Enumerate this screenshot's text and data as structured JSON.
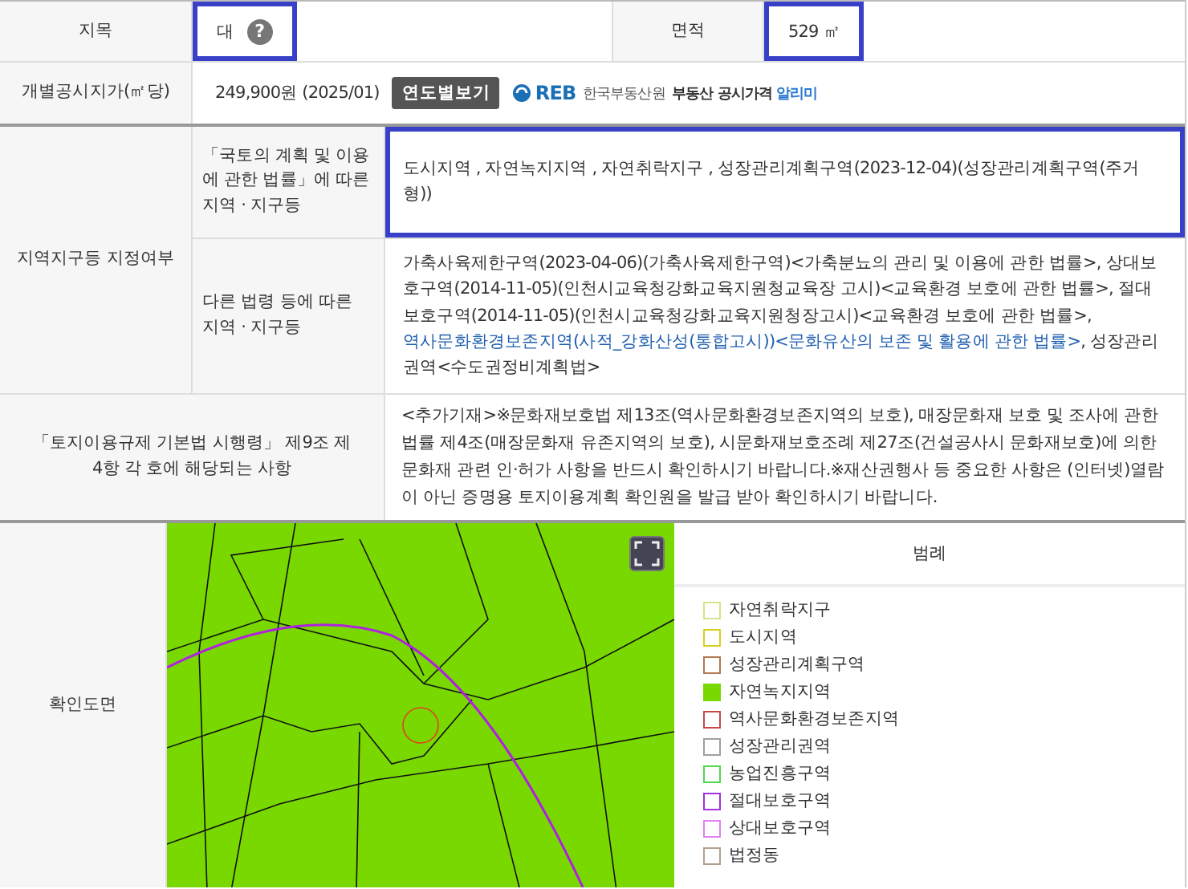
{
  "land_category": {
    "label": "지목",
    "value": "대",
    "help_icon": "?",
    "highlighted": true
  },
  "area": {
    "label": "면적",
    "value": "529 ㎡",
    "highlighted": true
  },
  "official_price": {
    "label": "개별공시지가(㎡당)",
    "value": "249,900원 (2025/01)",
    "button": "연도별보기",
    "logo": {
      "mark": "REB",
      "org": "한국부동산원",
      "service": "부동산 공시가격",
      "brand": "알리미"
    }
  },
  "zoning": {
    "label": "지역지구등 지정여부",
    "rows": [
      {
        "label": "「국토의 계획 및 이용에 관한 법률」에 따른 지역 · 지구등",
        "highlighted": true,
        "segments": [
          {
            "text": "도시지역 , 자연녹지지역 , 자연취락지구 , 성장관리계획구역(2023-12-04)(성장관리계획구역(주거형))",
            "link": false
          }
        ]
      },
      {
        "label": "다른 법령 등에 따른 지역 · 지구등",
        "highlighted": false,
        "segments": [
          {
            "text": "가축사육제한구역(2023-04-06)(가축사육제한구역)<가축분뇨의 관리 및 이용에 관한 법률>, 상대보호구역(2014-11-05)(인천시교육청강화교육지원청교육장 고시)<교육환경 보호에 관한 법률>, 절대보호구역(2014-11-05)(인천시교육청강화교육지원청장고시)<교육환경 보호에 관한 법률>, ",
            "link": false
          },
          {
            "text": "역사문화환경보존지역(사적_강화산성(통합고시))<문화유산의 보존 및 활용에 관한 법률>",
            "link": true
          },
          {
            "text": ", 성장관리권역<수도권정비계획법>",
            "link": false
          }
        ]
      }
    ]
  },
  "regulation": {
    "label": "「토지이용규제 기본법 시행령」 제9조 제4항 각 호에 해당되는 사항",
    "text": "<추가기재>※문화재보호법 제13조(역사문화환경보존지역의 보호), 매장문화재 보호 및 조사에 관한 법률 제4조(매장문화재 유존지역의 보호), 시문화재보호조례 제27조(건설공사시 문화재보호)에 의한 문화재 관련 인·허가 사항을 반드시 확인하시기 바랍니다.※재산권행사 등 중요한 사항은 (인터넷)열람이 아닌 증명용 토지이용계획 확인원을 발급 받아 확인하시기 바랍니다."
  },
  "map": {
    "label": "확인도면",
    "legend_title": "범례",
    "legend": [
      {
        "label": "자연취락지구",
        "color": "#d8e08a",
        "kind": "outline"
      },
      {
        "label": "도시지역",
        "color": "#d8d020",
        "kind": "outline"
      },
      {
        "label": "성장관리계획구역",
        "color": "#b07850",
        "kind": "outline"
      },
      {
        "label": "자연녹지지역",
        "color": "#78d800",
        "kind": "filled"
      },
      {
        "label": "역사문화환경보존지역",
        "color": "#c84848",
        "kind": "outline"
      },
      {
        "label": "성장관리권역",
        "color": "#a0a0a0",
        "kind": "outline"
      },
      {
        "label": "농업진흥구역",
        "color": "#50d850",
        "kind": "outline"
      },
      {
        "label": "절대보호구역",
        "color": "#a030e0",
        "kind": "outline"
      },
      {
        "label": "상대보호구역",
        "color": "#e080f0",
        "kind": "outline"
      },
      {
        "label": "법정동",
        "color": "#b0a090",
        "kind": "outline"
      }
    ]
  }
}
